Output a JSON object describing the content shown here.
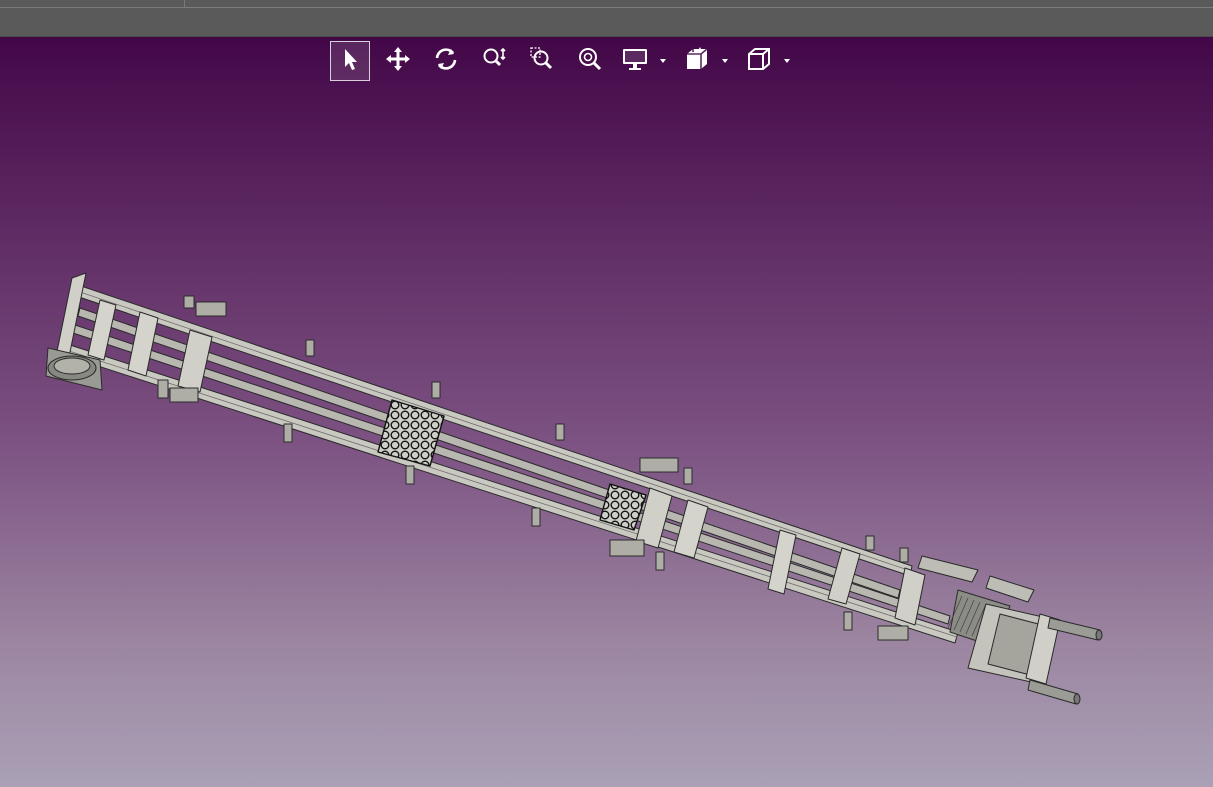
{
  "window": {
    "active_tab": ""
  },
  "toolbar": {
    "buttons": [
      {
        "id": "select",
        "icon": "select-arrow-icon",
        "active": true
      },
      {
        "id": "pan",
        "icon": "pan-move-icon",
        "active": false
      },
      {
        "id": "rotate",
        "icon": "rotate-icon",
        "active": false
      },
      {
        "id": "zoom",
        "icon": "zoom-icon",
        "active": false
      },
      {
        "id": "zoom-window",
        "icon": "zoom-window-icon",
        "active": false
      },
      {
        "id": "zoom-fit",
        "icon": "zoom-fit-icon",
        "active": false
      },
      {
        "id": "display",
        "icon": "display-monitor-icon",
        "active": false,
        "dropdown": true
      },
      {
        "id": "render-style",
        "icon": "render-style-icon",
        "active": false,
        "dropdown": true
      },
      {
        "id": "view-orientation",
        "icon": "view-cube-icon",
        "active": false,
        "dropdown": true
      }
    ]
  },
  "colors": {
    "topbar": "#5a5a5a",
    "bg_top": "#430748",
    "bg_bottom": "#aaa1b6",
    "model_fill": "#c9c9c2",
    "model_edge": "#2a2a2a"
  }
}
